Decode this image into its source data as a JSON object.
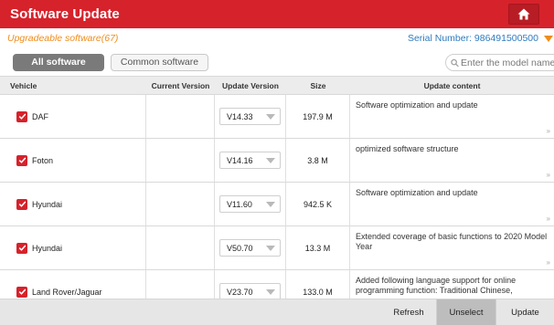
{
  "header": {
    "title": "Software Update",
    "home_icon": "home-icon"
  },
  "subbar": {
    "upgradeable": "Upgradeable software(67)",
    "serial": "Serial Number: 986491500500"
  },
  "filters": {
    "all_label": "All software",
    "common_label": "Common software",
    "search_placeholder": "Enter the model name"
  },
  "table": {
    "headers": {
      "vehicle": "Vehicle",
      "current": "Current Version",
      "update": "Update Version",
      "size": "Size",
      "content": "Update content"
    },
    "rows": [
      {
        "vehicle": "DAF",
        "current": "",
        "update": "V14.33",
        "size": "197.9 M",
        "content": "Software optimization and update"
      },
      {
        "vehicle": "Foton",
        "current": "",
        "update": "V14.16",
        "size": "3.8 M",
        "content": " optimized software structure"
      },
      {
        "vehicle": "Hyundai",
        "current": "",
        "update": "V11.60",
        "size": "942.5 K",
        "content": "Software optimization and update"
      },
      {
        "vehicle": "Hyundai",
        "current": "",
        "update": "V50.70",
        "size": "13.3 M",
        "content": "Extended coverage of basic functions to 2020 Model Year"
      },
      {
        "vehicle": "Land Rover/Jaguar",
        "current": "",
        "update": "V23.70",
        "size": "133.0 M",
        "content": "Added following language support for online programming function: Traditional Chinese,"
      }
    ]
  },
  "footer": {
    "refresh": "Refresh",
    "unselect": "Unselect",
    "update": "Update"
  },
  "colors": {
    "brand_red": "#d6222b",
    "accent_orange": "#f08c1a",
    "serial_blue": "#2f7bc1"
  }
}
